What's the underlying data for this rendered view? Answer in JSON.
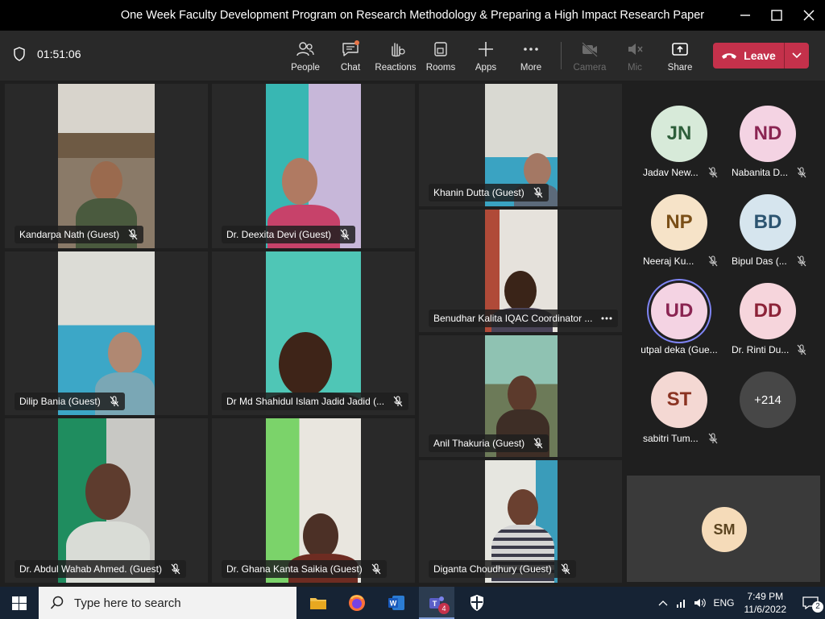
{
  "window": {
    "title": "One Week Faculty Development Program on Research Methodology & Preparing a High Impact Research Paper"
  },
  "meeting": {
    "timer": "01:51:06",
    "buttons": {
      "people": "People",
      "chat": "Chat",
      "reactions": "Reactions",
      "rooms": "Rooms",
      "apps": "Apps",
      "more": "More",
      "camera": "Camera",
      "mic": "Mic",
      "share": "Share",
      "leave": "Leave"
    }
  },
  "video_tiles": [
    {
      "name": "Kandarpa Nath (Guest)"
    },
    {
      "name": "Dr. Deexita Devi (Guest)"
    },
    {
      "name": "Khanin Dutta (Guest)"
    },
    {
      "name": "Benudhar Kalita IQAC Coordinator ..."
    },
    {
      "name": "Dilip Bania (Guest)"
    },
    {
      "name": "Dr Md Shahidul Islam Jadid Jadid (..."
    },
    {
      "name": "Anil Thakuria (Guest)"
    },
    {
      "name": "Dr. Abdul Wahab Ahmed. (Guest)"
    },
    {
      "name": "Dr. Ghana Kanta Saikia (Guest)"
    },
    {
      "name": "Diganta Choudhury (Guest)"
    }
  ],
  "avatars": [
    {
      "initials": "JN",
      "name": "Jadav New...",
      "bg": "#d7ead9",
      "fg": "#2d5e3a"
    },
    {
      "initials": "ND",
      "name": "Nabanita D...",
      "bg": "#f4d3e3",
      "fg": "#8a2452"
    },
    {
      "initials": "NP",
      "name": "Neeraj Ku...",
      "bg": "#f6e3c8",
      "fg": "#7a4f17"
    },
    {
      "initials": "BD",
      "name": "Bipul Das (...",
      "bg": "#d6e5ee",
      "fg": "#2c5470"
    },
    {
      "initials": "UD",
      "name": "utpal deka (Gue...",
      "bg": "#f4d3e3",
      "fg": "#8a2452"
    },
    {
      "initials": "DD",
      "name": "Dr. Rinti Du...",
      "bg": "#f6d5dc",
      "fg": "#8c2338"
    },
    {
      "initials": "ST",
      "name": "sabitri Tum...",
      "bg": "#f4d8d3",
      "fg": "#8a3322"
    },
    {
      "initials": "+214",
      "name": "",
      "bg": "#474747",
      "fg": "#ffffff"
    }
  ],
  "spotlight": {
    "initials": "SM"
  },
  "taskbar": {
    "search_placeholder": "Type here to search",
    "teams_badge": "4",
    "language": "ENG",
    "time": "7:49 PM",
    "date": "11/6/2022",
    "notifications": "2"
  }
}
